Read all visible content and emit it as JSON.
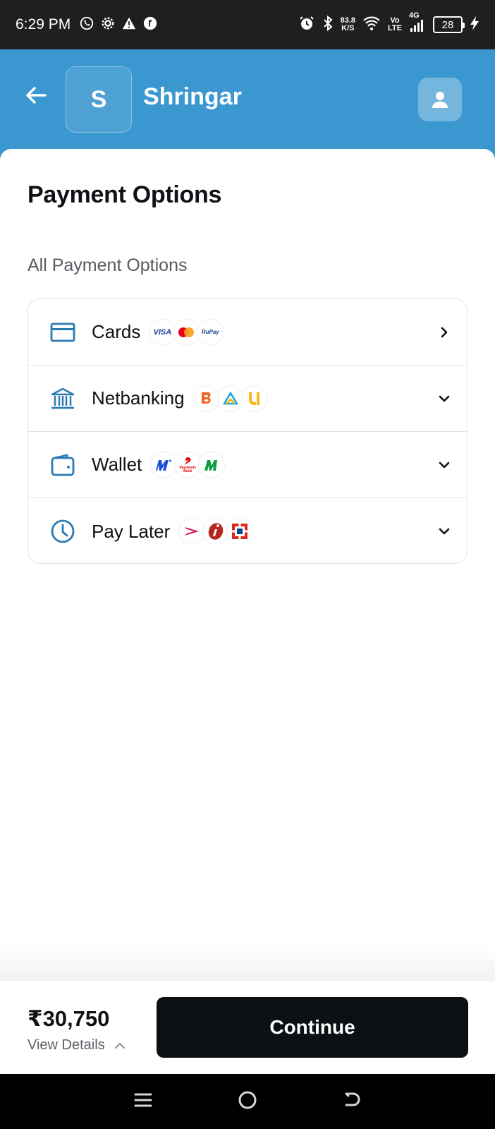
{
  "status_bar": {
    "time": "6:29 PM",
    "net_speed_value": "83.8",
    "net_speed_unit": "K/S",
    "volte_top": "Vo",
    "volte_bottom": "LTE",
    "network": "4G",
    "battery": "28"
  },
  "header": {
    "merchant_initial": "S",
    "merchant_name": "Shringar",
    "color": "#3a97d0"
  },
  "main": {
    "title": "Payment Options",
    "section_label": "All Payment Options",
    "options": [
      {
        "label": "Cards",
        "icon": "card-icon",
        "chevron": "right",
        "logos": [
          "VISA",
          "mastercard",
          "RuPay"
        ]
      },
      {
        "label": "Netbanking",
        "icon": "bank-icon",
        "chevron": "down",
        "logos": [
          "bank-of-baroda",
          "sbi",
          "pnb"
        ]
      },
      {
        "label": "Wallet",
        "icon": "wallet-icon",
        "chevron": "down",
        "logos": [
          "mobikwik",
          "airtel-payments-bank",
          "m-wallet"
        ]
      },
      {
        "label": "Pay Later",
        "icon": "clock-icon",
        "chevron": "down",
        "logos": [
          "lazypay",
          "icici",
          "hdfc"
        ]
      }
    ],
    "logo_text": {
      "visa": "VISA",
      "rupay": "RuPay",
      "airtel": "Payments Bank"
    }
  },
  "footer": {
    "amount": "₹30,750",
    "view_details": "View Details",
    "continue_label": "Continue"
  }
}
